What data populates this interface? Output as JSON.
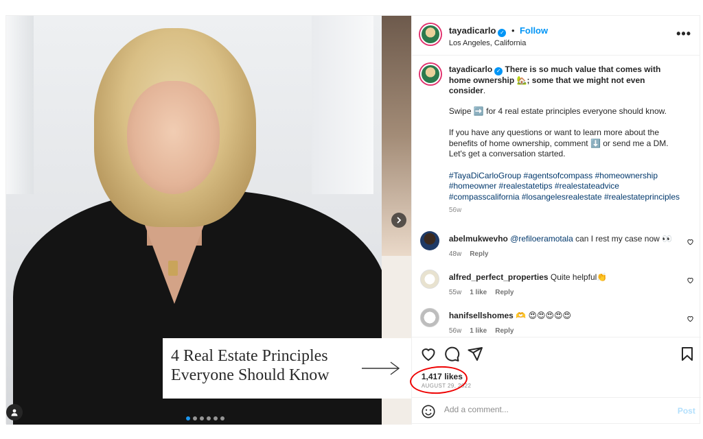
{
  "media": {
    "caption_line1": "4 Real Estate Principles",
    "caption_line2": "Everyone Should Know",
    "slide_count": 6,
    "active_slide": 1
  },
  "header": {
    "username": "tayadicarlo",
    "separator": "•",
    "follow_label": "Follow",
    "location": "Los Angeles, California",
    "more_icon": "more-options-icon"
  },
  "caption": {
    "username": "tayadicarlo",
    "bold_text": "There is so much value that comes with home ownership 🏡; some that we might not even consider",
    "bold_end": ".",
    "swipe_before": "Swipe",
    "swipe_emoji": "➡️",
    "swipe_after": "for 4 real estate principles everyone should know.",
    "questions_before": "If you have any questions or want to learn more about the benefits of home ownership, comment",
    "questions_emoji": "⬇️",
    "questions_after": "or send me a DM. Let's get a conversation started.",
    "hashtags": "#TayaDiCarloGroup #agentsofcompass #homeownership #homeowner #realestatetips #realestateadvice #compasscalifornia #losangelesrealestate #realestateprinciples",
    "time": "56w"
  },
  "comments": [
    {
      "username": "abelmukwevho",
      "mention": "@refiloeramotala",
      "text": "can I rest my case now 👀",
      "time": "48w",
      "likes": "",
      "reply": "Reply"
    },
    {
      "username": "alfred_perfect_properties",
      "mention": "",
      "text": "Quite helpful👏",
      "time": "55w",
      "likes": "1 like",
      "reply": "Reply"
    },
    {
      "username": "hanifsellshomes",
      "mention": "",
      "text": "🫶 😍😍😍😍😍",
      "time": "56w",
      "likes": "1 like",
      "reply": "Reply"
    }
  ],
  "actions": {
    "likes": "1,417 likes",
    "date": "AUGUST 29, 2022"
  },
  "add_comment": {
    "placeholder": "Add a comment...",
    "post_label": "Post"
  },
  "colors": {
    "link_blue": "#0095f6",
    "hashtag": "#00376b",
    "annotation_circle": "#e00000"
  }
}
